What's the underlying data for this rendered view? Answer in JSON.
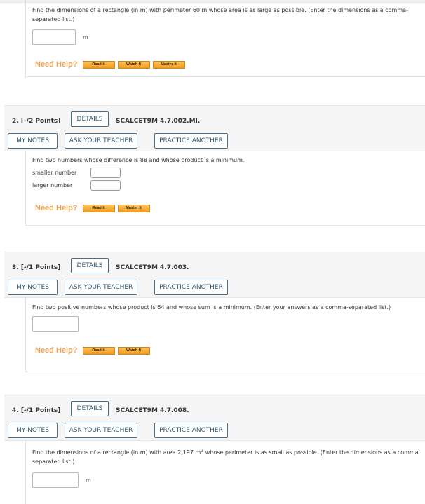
{
  "help": {
    "label": "Need Help?",
    "read": "Read It",
    "watch": "Watch It",
    "master": "Master It"
  },
  "header_buttons": {
    "details": "DETAILS",
    "my_notes": "MY NOTES",
    "ask_teacher": "ASK YOUR TEACHER",
    "practice": "PRACTICE ANOTHER"
  },
  "q1": {
    "text": "Find the dimensions of a rectangle (in m) with perimeter 60 m whose area is as large as possible. (Enter the dimensions as a comma-separated list.)",
    "unit": "m",
    "answer": ""
  },
  "q2": {
    "number": "2.",
    "points": "[-/2 Points]",
    "code": "SCALCET9M 4.7.002.MI.",
    "text": "Find two numbers whose difference is 88 and whose product is a minimum.",
    "smaller_label": "smaller number",
    "larger_label": "larger number",
    "smaller_value": "",
    "larger_value": ""
  },
  "q3": {
    "number": "3.",
    "points": "[-/1 Points]",
    "code": "SCALCET9M 4.7.003.",
    "text": "Find two positive numbers whose product is 64 and whose sum is a minimum. (Enter your answers as a comma-separated list.)",
    "answer": ""
  },
  "q4": {
    "number": "4.",
    "points": "[-/1 Points]",
    "code": "SCALCET9M 4.7.008.",
    "text_before": "Find the dimensions of a rectangle (in m) with area 2,197 m",
    "superscript": "2",
    "text_after": " whose perimeter is as small as possible. (Enter the dimensions as a comma separated list.)",
    "unit": "m",
    "answer": ""
  },
  "colors": {
    "button_border": "#4c6f86",
    "button_text": "#2f5873",
    "help_label": "#e6a055",
    "help_button": "#f5a623",
    "header_bg": "#f5f5f5"
  }
}
